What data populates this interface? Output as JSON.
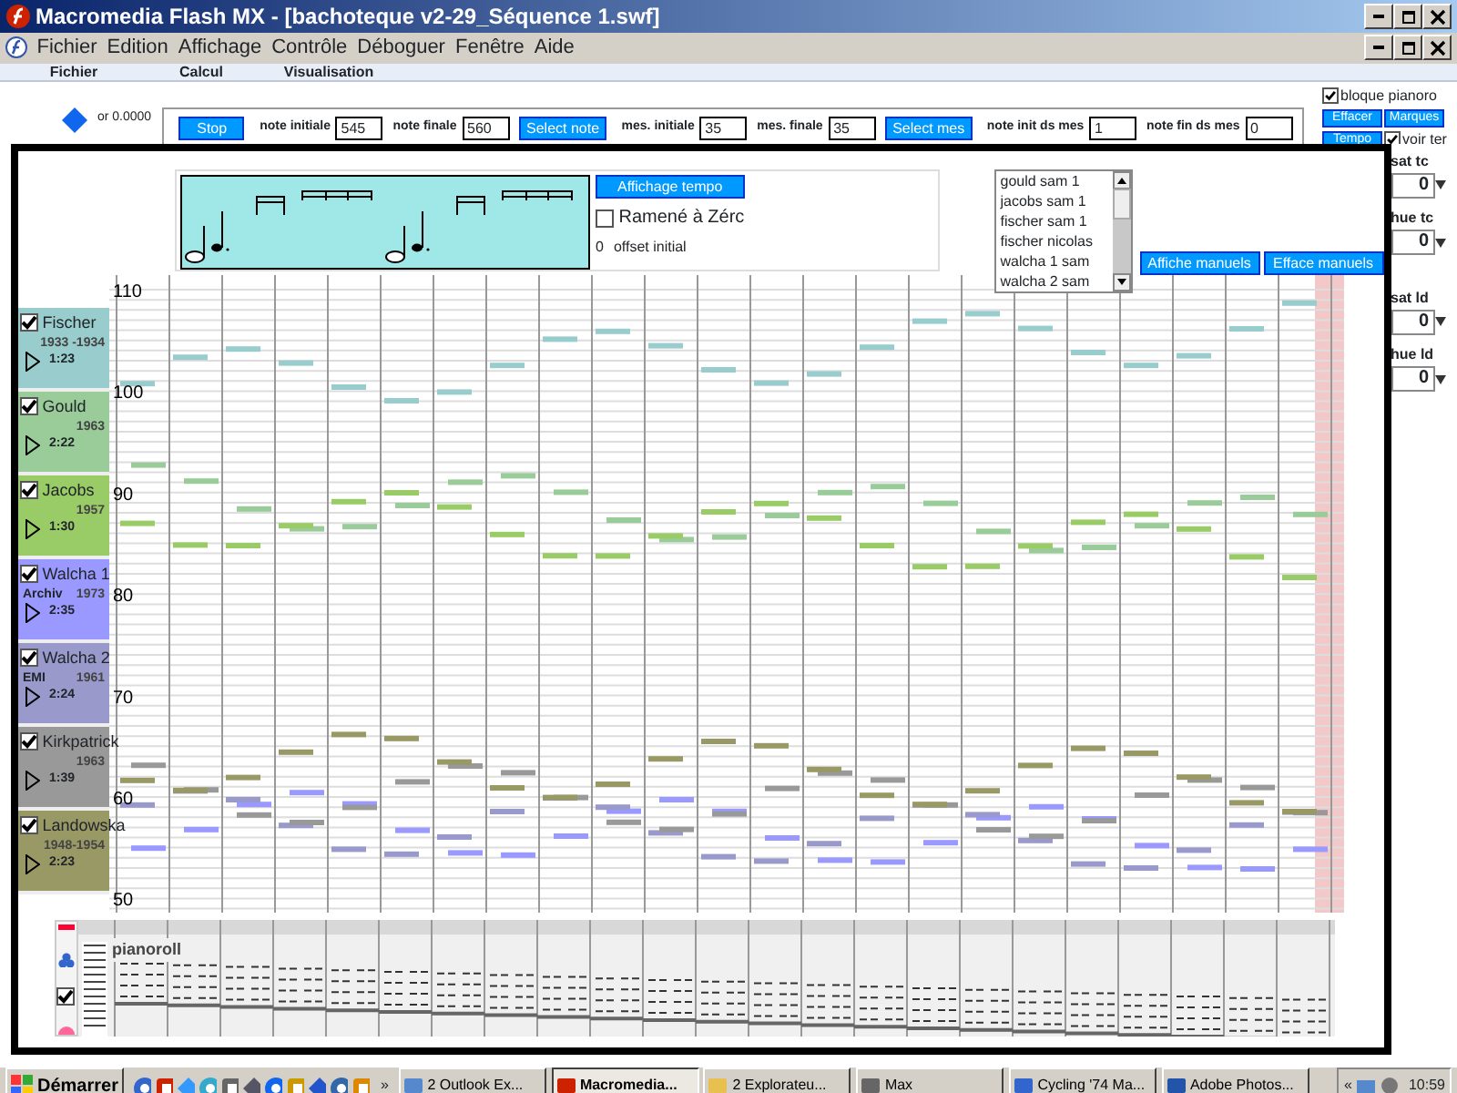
{
  "window": {
    "title": "Macromedia Flash MX - [bachoteque v2-29_Séquence 1.swf]"
  },
  "menu": [
    "Fichier",
    "Edition",
    "Affichage",
    "Contrôle",
    "Déboguer",
    "Fenêtre",
    "Aide"
  ],
  "tabs": [
    "Fichier",
    "Calcul",
    "Visualisation"
  ],
  "toolbar": {
    "readout": "or 0.0000",
    "controls": [
      {
        "kind": "button",
        "label": "Stop"
      },
      {
        "kind": "field",
        "label": "note initiale",
        "value": "545"
      },
      {
        "kind": "field",
        "label": "note finale",
        "value": "560"
      },
      {
        "kind": "button",
        "label": "Select note"
      },
      {
        "kind": "field",
        "label": "mes. initiale",
        "value": "35"
      },
      {
        "kind": "field",
        "label": "mes. finale",
        "value": "35"
      },
      {
        "kind": "button",
        "label": "Select mes"
      },
      {
        "kind": "field",
        "label": "note init ds mes",
        "value": "1"
      },
      {
        "kind": "field",
        "label": "note fin ds mes",
        "value": "0"
      }
    ]
  },
  "side_controls": [
    {
      "kind": "check",
      "label": "bloque pianoro",
      "checked": true
    },
    {
      "kind": "button",
      "label": "Effacer"
    },
    {
      "kind": "button",
      "label": "Marques"
    },
    {
      "kind": "button",
      "label": "Tempo"
    },
    {
      "kind": "check",
      "label": "voir ter",
      "checked": true
    }
  ],
  "spinners": [
    {
      "label": "sat tc",
      "value": "0"
    },
    {
      "label": "hue tc",
      "value": "0"
    },
    {
      "label": "sat ld",
      "value": "0"
    },
    {
      "label": "hue ld",
      "value": "0"
    }
  ],
  "tempo": {
    "button": "Affichage tempo",
    "reset": {
      "label": "Ramené à Zérc",
      "checked": false
    },
    "offset_value": "0",
    "offset_label": "offset initial"
  },
  "recordings": [
    "gould sam 1",
    "jacobs sam 1",
    "fischer sam 1",
    "fischer nicolas",
    "walcha 1 sam",
    "walcha 2 sam"
  ],
  "manual_buttons": [
    "Affiche manuels",
    "Efface manuels"
  ],
  "tracks": [
    {
      "name": "Fischer",
      "years": "1933 -1934",
      "duration": "1:23",
      "color": "#99cccc",
      "checked": true
    },
    {
      "name": "Gould",
      "years": "1963",
      "duration": "2:22",
      "color": "#99cc99",
      "checked": true
    },
    {
      "name": "Jacobs",
      "years": "1957",
      "duration": "1:30",
      "color": "#99cc66",
      "checked": true
    },
    {
      "name": "Walcha 1",
      "label": "Archiv",
      "years": "1973",
      "duration": "2:35",
      "color": "#9999ff",
      "checked": true
    },
    {
      "name": "Walcha 2",
      "label": "EMI",
      "years": "1961",
      "duration": "2:24",
      "color": "#9999cc",
      "checked": true
    },
    {
      "name": "Kirkpatrick",
      "years": "1963",
      "duration": "1:39",
      "color": "#999999",
      "checked": true
    },
    {
      "name": "Landowska",
      "years": "1948-1954",
      "duration": "2:23",
      "color": "#999966",
      "checked": true
    }
  ],
  "pitch_labels": [
    "110",
    "100",
    "90",
    "80",
    "70",
    "60",
    "50"
  ],
  "overview": {
    "label": "pianoroll",
    "checked": true
  },
  "taskbar": {
    "start": "Démarrer",
    "more": "»",
    "tasks": [
      {
        "label": "2 Outlook Ex...",
        "selected": false
      },
      {
        "label": "Macromedia...",
        "selected": true
      },
      {
        "label": "2 Explorateu...",
        "selected": false
      },
      {
        "label": "Max",
        "selected": false
      },
      {
        "label": "Cycling '74 Ma...",
        "selected": false
      },
      {
        "label": "Adobe Photos...",
        "selected": false
      }
    ],
    "tray_toggle": "«",
    "clock": "10:59"
  }
}
